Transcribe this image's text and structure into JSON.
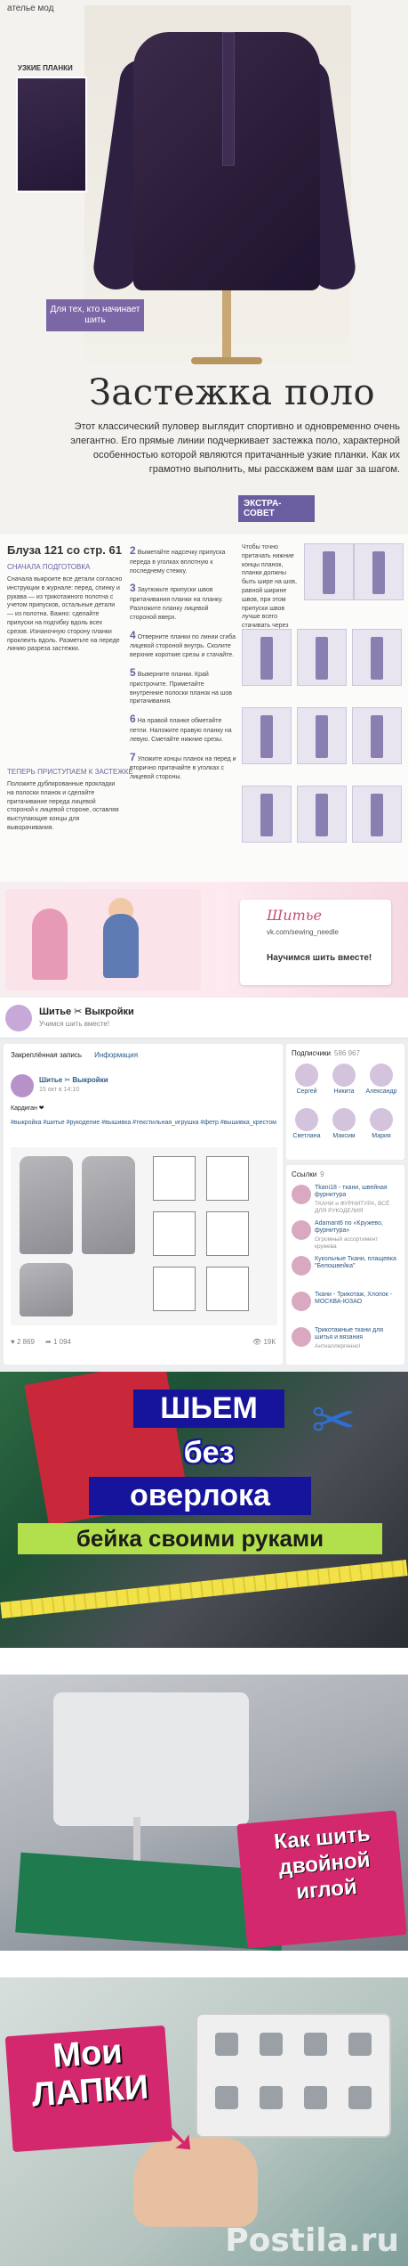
{
  "magazine": {
    "header_tag": "ателье мод",
    "detail_label": "УЗКИЕ ПЛАНКИ",
    "teaser": "Для тех, кто начинает шить",
    "title": "Застежка поло",
    "intro": "Этот классический пуловер выглядит спортивно и одновременно очень элегантно. Его прямые линии подчеркивает застежка поло, характерной особенностью которой являются притачанные узкие планки. Как их грамотно выполнить, мы расскажем вам шаг за шагом.",
    "expert_badge": "ЭКСТРА-СОВЕТ"
  },
  "instructions": {
    "title": "Блуза 121 со стр. 61",
    "subhead": "Сначала подготовка",
    "col1": "Сначала выкроите все детали согласно инструкции в журнале: перед, спинку и рукава — из трикотажного полотна с учетом припусков, остальные детали — из полотна. Важно: сделайте припуски на подгибку вдоль всех срезов. Изнаночную сторону планки проклеить вдоль. Разметьте на переде линию разреза застежки.",
    "col2_steps": [
      "Выметайте надсечку припуска переда в уголках вплотную к последнему стежку.",
      "Заутюжьте припуски швов притачивания планки на планку. Разложите планку лицевой стороной вверх.",
      "Отверните планки по линии сгиба лицевой стороной внутрь. Сколите верхние короткие срезы и стачайте.",
      "Выверните планки. Край пристрочите. Приметайте внутренние полоски планок на шов притачивания.",
      "На правой планке обметайте петли. Наложите правую планку на левую. Сметайте нижние срезы.",
      "Уложите концы планок на перед и вторично притачайте в уголках с лицевой стороны."
    ],
    "col3": "Чтобы точно притачать нижние концы планок, планки должны быть шире на шов, равной ширине швов, при этом припуски швов лучше всего стачивать через толщину бумаги.",
    "section2": "ТЕПЕРЬ ПРИСТУПАЕМ К ЗАСТЕЖКЕ",
    "col4": "Положите дублированные прокладки на полоски планок и сделайте притачивание переда лицевой стороной к лицевой стороне, оставляя выступающие концы для выворачивания."
  },
  "banner": {
    "name": "Шитье",
    "url": "vk.com/sewing_needle",
    "slogan": "Научимся шить вместе!"
  },
  "vk": {
    "group_name": "Шитье ✂ Выкройки",
    "group_status": "Учимся шить вместе!",
    "tabs": [
      "Закреплённая запись",
      "Информация"
    ],
    "post": {
      "author": "Шитье ✂ Выкройки",
      "date": "15 окт в 14:10",
      "text": "Кардиган ❤",
      "tags": "#выкройка #шитье #рукоделие #вышивка #текстильная_игрушка #фетр #вышивка_крестом",
      "likes": "2 869",
      "shares": "1 094",
      "views": "19К"
    },
    "members": {
      "title": "Подписчики",
      "count": "586 967",
      "people": [
        "Сергей",
        "Никита",
        "Александр",
        "Светлана",
        "Максим",
        "Мария"
      ]
    },
    "links": {
      "title": "Ссылки",
      "count": "9",
      "items": [
        {
          "name": "Тkani18 - ткани, швейная фурнитура",
          "desc": "ТКАНИ и ФУРНИТУРА, ВСЁ ДЛЯ РУКОДЕЛИЯ"
        },
        {
          "name": "Adamant6 по «Кружево, фурнитура»",
          "desc": "Огромный ассортимент кружева"
        },
        {
          "name": "Кукольные Ткани, плащевка \"Белошвейка\"",
          "desc": ""
        },
        {
          "name": "Ткани - Трикотаж, Хлопок - МОСКВА-ЮЗАО",
          "desc": ""
        },
        {
          "name": "Трикотажные ткани для шитья и вязания",
          "desc": "Антиаллергенно!"
        }
      ]
    }
  },
  "videos": {
    "v1_lines": [
      "ШЬЕМ",
      "без",
      "оверлока",
      "бейка своими руками"
    ],
    "v2_text": "Как шить двойной иглой",
    "v3_text": "Мои ЛАПКИ",
    "watermark": "Postila.ru"
  }
}
